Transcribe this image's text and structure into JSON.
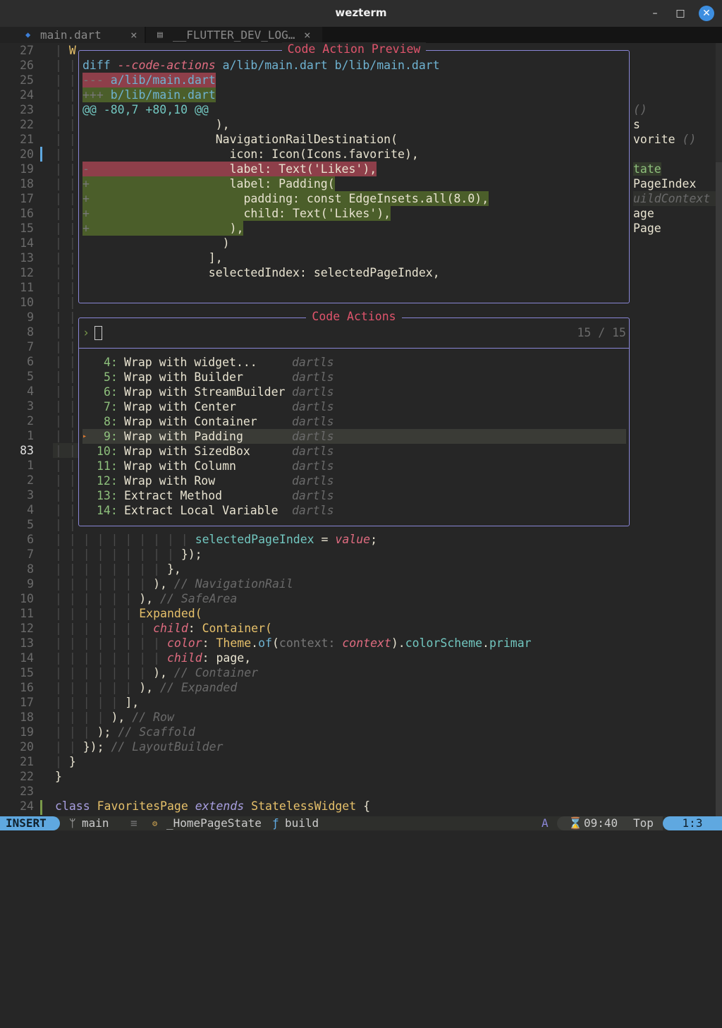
{
  "window": {
    "title": "wezterm",
    "minimize": "–",
    "maximize": "□",
    "close": "✕"
  },
  "tabs": [
    {
      "label": "main.dart",
      "icon": "dart-file-icon",
      "close": "×"
    },
    {
      "label": "__FLUTTER_DEV_LOG…",
      "icon": "file-icon",
      "close": "×"
    }
  ],
  "gutter": [
    "27",
    "26",
    "25",
    "24",
    "23",
    "22",
    "21",
    "20",
    "19",
    "18",
    "17",
    "16",
    "15",
    "14",
    "13",
    "12",
    "11",
    "10",
    "9",
    "8",
    "7",
    "6",
    "5",
    "4",
    "3",
    "2",
    "1",
    "83",
    "1",
    "2",
    "3",
    "4",
    "5",
    "6",
    "7",
    "8",
    "9",
    "10",
    "11",
    "12",
    "13",
    "14",
    "15",
    "16",
    "17",
    "18",
    "19",
    "20",
    "21",
    "22",
    "23",
    "24"
  ],
  "code_rows": {
    "0": [
      [
        "| ",
        "g"
      ],
      [
        "W",
        "y"
      ]
    ],
    "33": [
      [
        "| | | | | | | | | | ",
        "g"
      ],
      [
        "selectedPageIndex",
        "t"
      ],
      [
        " = ",
        "w"
      ],
      [
        "value",
        "p"
      ],
      [
        ";",
        "w"
      ]
    ],
    "34": [
      [
        "| | | | | | | | | ",
        "g"
      ],
      [
        "});",
        "w"
      ]
    ],
    "35": [
      [
        "| | | | | | | | ",
        "g"
      ],
      [
        "},",
        "w"
      ]
    ],
    "36": [
      [
        "| | | | | | | ",
        "g"
      ],
      [
        "), ",
        "w"
      ],
      [
        "// NavigationRail",
        "c"
      ]
    ],
    "37": [
      [
        "| | | | | | ",
        "g"
      ],
      [
        "), ",
        "w"
      ],
      [
        "// SafeArea",
        "c"
      ]
    ],
    "38": [
      [
        "| | | | | | ",
        "g"
      ],
      [
        "Expanded(",
        "y"
      ]
    ],
    "39": [
      [
        "| | | | | | | ",
        "g"
      ],
      [
        "child",
        "p"
      ],
      [
        ": ",
        "w"
      ],
      [
        "Container(",
        "y"
      ]
    ],
    "40": [
      [
        "| | | | | | | | ",
        "g"
      ],
      [
        "color",
        "p"
      ],
      [
        ": ",
        "w"
      ],
      [
        "Theme",
        "y"
      ],
      [
        ".",
        "w"
      ],
      [
        "of",
        "b"
      ],
      [
        "(",
        "w"
      ],
      [
        "context: ",
        "dim"
      ],
      [
        "context",
        "p"
      ],
      [
        ").",
        "w"
      ],
      [
        "colorScheme",
        "t"
      ],
      [
        ".",
        "w"
      ],
      [
        "primar",
        "t"
      ]
    ],
    "41": [
      [
        "| | | | | | | | ",
        "g"
      ],
      [
        "child",
        "p"
      ],
      [
        ": page,",
        "w"
      ]
    ],
    "42": [
      [
        "| | | | | | | ",
        "g"
      ],
      [
        "), ",
        "w"
      ],
      [
        "// Container",
        "c"
      ]
    ],
    "43": [
      [
        "| | | | | | ",
        "g"
      ],
      [
        "), ",
        "w"
      ],
      [
        "// Expanded",
        "c"
      ]
    ],
    "44": [
      [
        "| | | | | ",
        "g"
      ],
      [
        "],",
        "w"
      ]
    ],
    "45": [
      [
        "| | | | ",
        "g"
      ],
      [
        "), ",
        "w"
      ],
      [
        "// Row",
        "c"
      ]
    ],
    "46": [
      [
        "| | | ",
        "g"
      ],
      [
        "); ",
        "w"
      ],
      [
        "// Scaffold",
        "c"
      ]
    ],
    "47": [
      [
        "| | ",
        "g"
      ],
      [
        "}); ",
        "w"
      ],
      [
        "// LayoutBuilder",
        "c"
      ]
    ],
    "48": [
      [
        "| ",
        "g"
      ],
      [
        "}",
        "w"
      ]
    ],
    "49": [
      [
        "}",
        "w"
      ]
    ],
    "51": [
      [
        "class ",
        "pu"
      ],
      [
        "FavoritesPage ",
        "y"
      ],
      [
        "extends ",
        "pi"
      ],
      [
        "StatelessWidget ",
        "y"
      ],
      [
        "{",
        "w"
      ]
    ]
  },
  "right_fragments": {
    "4": [
      [
        "()",
        "c"
      ]
    ],
    "5": [
      [
        "s",
        "w"
      ]
    ],
    "6": [
      [
        "vorite ",
        "w"
      ],
      [
        "()",
        "c"
      ]
    ],
    "8": [
      [
        "tate",
        "add-text"
      ]
    ],
    "9": [
      [
        "PageIndex",
        "w"
      ]
    ],
    "10": [
      [
        "uildContext",
        "c"
      ]
    ],
    "11": [
      [
        "age",
        "w"
      ]
    ],
    "12": [
      [
        "Page",
        "w"
      ]
    ]
  },
  "preview": {
    "title": "Code Action Preview",
    "lines": [
      {
        "kind": "header",
        "segments": [
          [
            "diff ",
            "b"
          ],
          [
            "--code-actions",
            "p"
          ],
          [
            " a/lib/main.dart b/lib/main.dart",
            "b"
          ]
        ]
      },
      {
        "kind": "del",
        "segments": [
          [
            "--- ",
            "dim"
          ],
          [
            "a/lib/main.dart",
            "b"
          ]
        ]
      },
      {
        "kind": "add",
        "segments": [
          [
            "+++ ",
            "dim"
          ],
          [
            "b/lib/main.dart",
            "b"
          ]
        ]
      },
      {
        "kind": "hunk",
        "segments": [
          [
            "@@ -80,7 +80,10 @@",
            "t"
          ]
        ]
      },
      {
        "kind": "ctx",
        "segments": [
          [
            "                   ),",
            "w"
          ]
        ]
      },
      {
        "kind": "ctx",
        "segments": [
          [
            "                   NavigationRailDestination(",
            "w"
          ]
        ]
      },
      {
        "kind": "ctx",
        "segments": [
          [
            "                     icon: Icon(Icons.favorite),",
            "w"
          ]
        ]
      },
      {
        "kind": "del",
        "segments": [
          [
            "-",
            "dim"
          ],
          [
            "                    label: Text('Likes'),",
            "w"
          ]
        ]
      },
      {
        "kind": "add",
        "segments": [
          [
            "+",
            "dim"
          ],
          [
            "                    label: Padding(",
            "w"
          ]
        ]
      },
      {
        "kind": "add",
        "segments": [
          [
            "+",
            "dim"
          ],
          [
            "                      padding: const EdgeInsets.all(8.0),",
            "w"
          ]
        ]
      },
      {
        "kind": "add",
        "segments": [
          [
            "+",
            "dim"
          ],
          [
            "                      child: Text('Likes'),",
            "w"
          ]
        ]
      },
      {
        "kind": "add",
        "segments": [
          [
            "+",
            "dim"
          ],
          [
            "                    ),",
            "w"
          ]
        ]
      },
      {
        "kind": "ctx",
        "segments": [
          [
            "                    )",
            "w"
          ]
        ]
      },
      {
        "kind": "ctx",
        "segments": [
          [
            "                  ],",
            "w"
          ]
        ]
      },
      {
        "kind": "ctx",
        "segments": [
          [
            "                  selectedIndex: selectedPageIndex,",
            "w"
          ]
        ]
      }
    ]
  },
  "actions": {
    "title": "Code Actions",
    "prompt": "›",
    "query": "",
    "count": "15 / 15",
    "selected": "9",
    "items": [
      {
        "num": "4:",
        "label": "Wrap with widget...",
        "source": "dartls"
      },
      {
        "num": "5:",
        "label": "Wrap with Builder",
        "source": "dartls"
      },
      {
        "num": "6:",
        "label": "Wrap with StreamBuilder",
        "source": "dartls"
      },
      {
        "num": "7:",
        "label": "Wrap with Center",
        "source": "dartls"
      },
      {
        "num": "8:",
        "label": "Wrap with Container",
        "source": "dartls"
      },
      {
        "num": "9:",
        "label": "Wrap with Padding",
        "source": "dartls"
      },
      {
        "num": "10:",
        "label": "Wrap with SizedBox",
        "source": "dartls"
      },
      {
        "num": "11:",
        "label": "Wrap with Column",
        "source": "dartls"
      },
      {
        "num": "12:",
        "label": "Wrap with Row",
        "source": "dartls"
      },
      {
        "num": "13:",
        "label": "Extract Method",
        "source": "dartls"
      },
      {
        "num": "14:",
        "label": "Extract Local Variable",
        "source": "dartls"
      }
    ]
  },
  "status": {
    "mode": "INSERT",
    "branch_icon": "ᛘ",
    "branch": "main",
    "list_icon": "≡",
    "class_icon": "⚙",
    "class": "_HomePageState",
    "fn_icon": "ƒ",
    "function": "build",
    "lsp": "A",
    "clock_icon": "⌛",
    "time": "09:40",
    "position": "Top",
    "cursor": "1:3"
  },
  "colors": {
    "accent": "#5fa8e0",
    "border": "#8a86d6",
    "title": "#e0546c",
    "diff_del": "#8e3f4a",
    "diff_add": "#4b5e2a"
  }
}
